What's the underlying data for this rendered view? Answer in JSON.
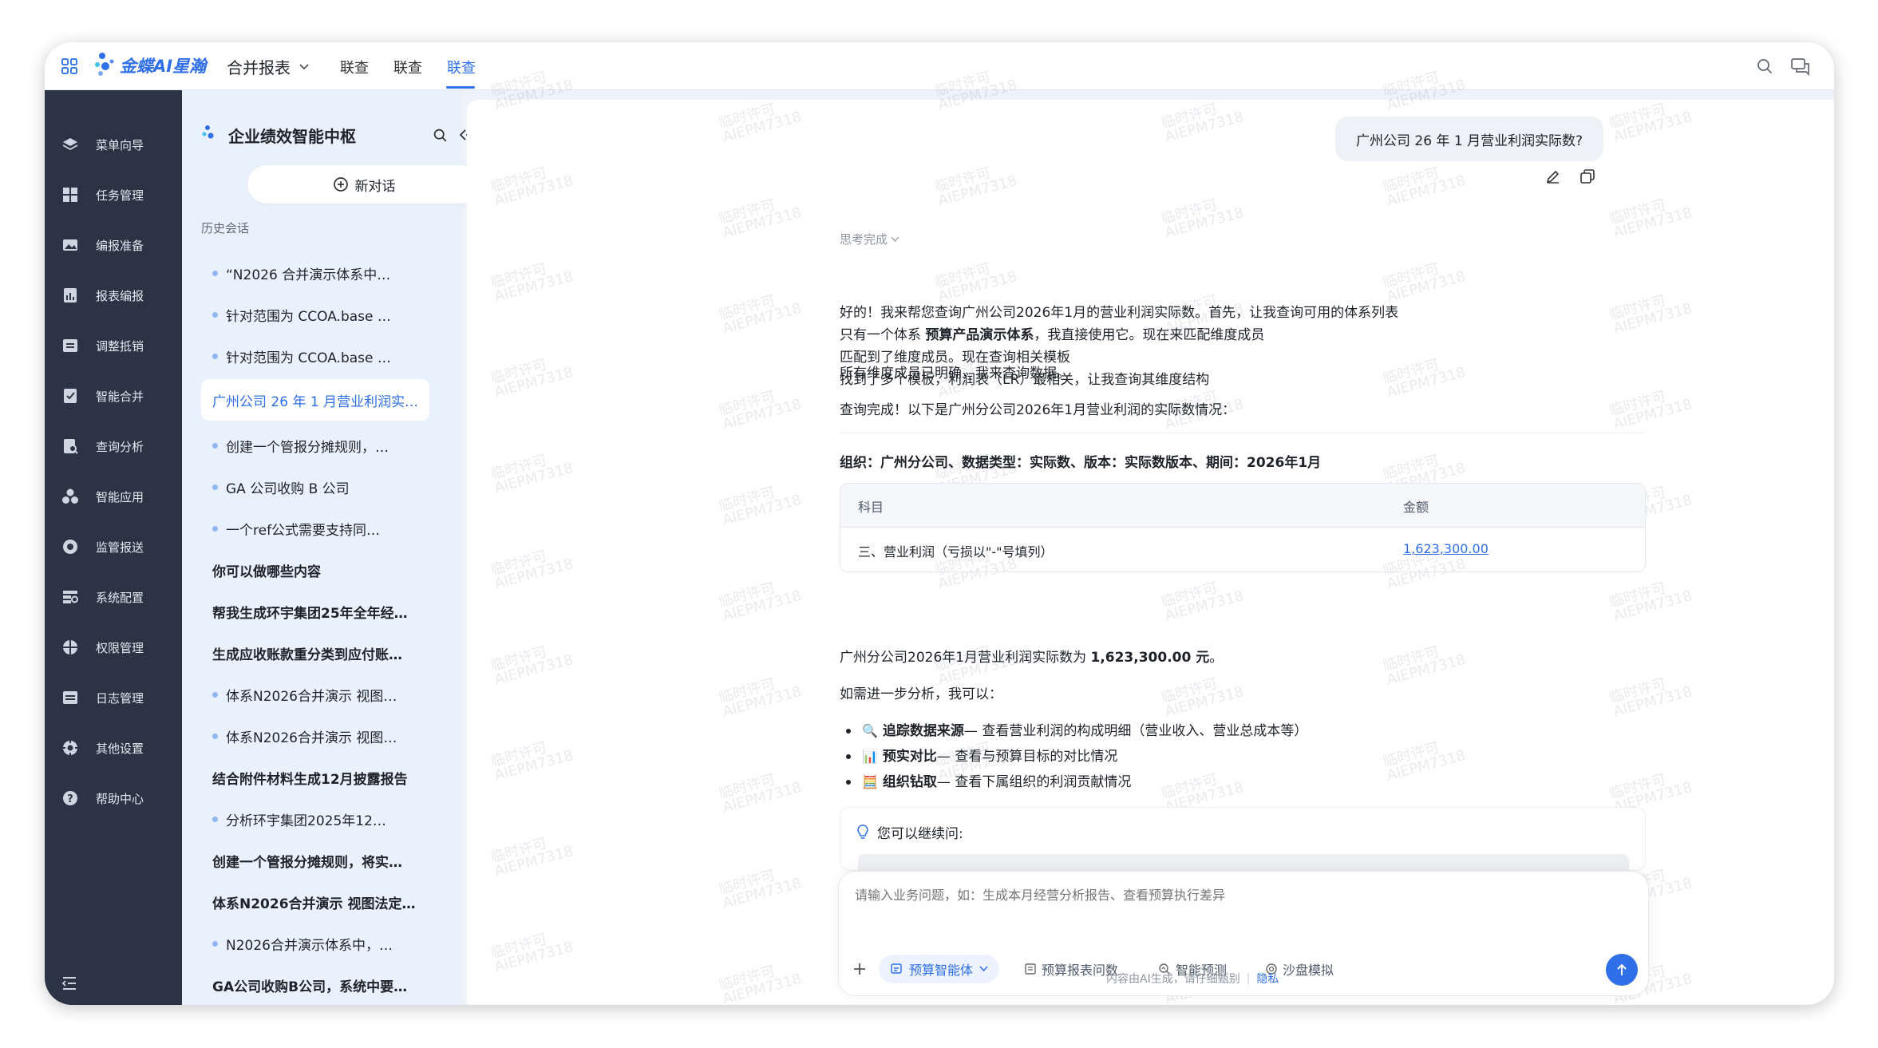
{
  "app": {
    "brand": "金蝶AI星瀚",
    "module": "合并报表",
    "tabs": [
      "联查",
      "联查",
      "联查"
    ],
    "active_tab_index": 2
  },
  "nav": {
    "items": [
      {
        "label": "菜单向导",
        "icon": "layers-icon"
      },
      {
        "label": "任务管理",
        "icon": "grid-icon"
      },
      {
        "label": "编报准备",
        "icon": "image-icon"
      },
      {
        "label": "报表编报",
        "icon": "report-icon"
      },
      {
        "label": "调整抵销",
        "icon": "adjust-icon"
      },
      {
        "label": "智能合并",
        "icon": "merge-icon"
      },
      {
        "label": "查询分析",
        "icon": "query-icon"
      },
      {
        "label": "智能应用",
        "icon": "apps-icon"
      },
      {
        "label": "监管报送",
        "icon": "target-icon"
      },
      {
        "label": "系统配置",
        "icon": "config-icon"
      },
      {
        "label": "权限管理",
        "icon": "shield-icon"
      },
      {
        "label": "日志管理",
        "icon": "log-icon"
      },
      {
        "label": "其他设置",
        "icon": "settings-icon"
      },
      {
        "label": "帮助中心",
        "icon": "help-icon"
      }
    ]
  },
  "panel": {
    "title": "企业绩效智能中枢",
    "new_chat": "新对话",
    "history_label": "历史会话",
    "history": [
      {
        "text": "“N2026 合并演示体系中…",
        "style": "dot"
      },
      {
        "text": "针对范围为 CCOA.base …",
        "style": "dot"
      },
      {
        "text": "针对范围为 CCOA.base …",
        "style": "dot"
      },
      {
        "text": "广州公司 26 年 1 月营业利润实…",
        "style": "active"
      },
      {
        "text": "创建一个管报分摊规则，…",
        "style": "dot"
      },
      {
        "text": "GA 公司收购 B 公司",
        "style": "dot"
      },
      {
        "text": "一个ref公式需要支持同…",
        "style": "dot"
      },
      {
        "text": "你可以做哪些内容",
        "style": "plain"
      },
      {
        "text": "帮我生成环宇集团25年全年经…",
        "style": "plain"
      },
      {
        "text": "生成应收账款重分类到应付账…",
        "style": "plain"
      },
      {
        "text": "体系N2026合并演示 视图…",
        "style": "dot"
      },
      {
        "text": "体系N2026合并演示 视图…",
        "style": "dot"
      },
      {
        "text": "结合附件材料生成12月披露报告",
        "style": "plain"
      },
      {
        "text": "分析环宇集团2025年12…",
        "style": "dot"
      },
      {
        "text": "创建一个管报分摊规则，将实…",
        "style": "plain"
      },
      {
        "text": "体系N2026合并演示 视图法定…",
        "style": "plain"
      },
      {
        "text": "N2026合并演示体系中，…",
        "style": "dot"
      },
      {
        "text": "GA公司收购B公司，系统中要…",
        "style": "plain"
      }
    ]
  },
  "chat": {
    "user_message": "广州公司 26 年 1 月营业利润实际数?",
    "thinking": "思考完成",
    "steps": [
      {
        "parts": [
          {
            "t": "好的！我来帮您查询广州公司2026年1月的营业利润实际数。首先，让我查询可用的体系列表",
            "b": false
          }
        ]
      },
      {
        "parts": [
          {
            "t": "只有一个体系 ",
            "b": false
          },
          {
            "t": "预算产品演示体系",
            "b": true
          },
          {
            "t": "，我直接使用它。现在来匹配维度成员",
            "b": false
          }
        ]
      },
      {
        "parts": [
          {
            "t": "匹配到了维度成员。现在查询相关模板",
            "b": false
          }
        ]
      },
      {
        "parts": [
          {
            "t": "找到了多个模板，利润表（LR）最相关，让我查询其维度结构",
            "b": false
          }
        ]
      }
    ],
    "members_clear": "所有维度成员已明确，我来查询数据。",
    "query_done": "查询完成！以下是广州分公司2026年1月营业利润的实际数情况：",
    "context_line": "组织：广州分公司、数据类型：实际数、版本：实际数版本、期间：2026年1月",
    "table": {
      "headers": [
        "科目",
        "金额"
      ],
      "rows": [
        {
          "subject": "三、营业利润（亏损以\"-\"号填列）",
          "amount": "1,623,300.00"
        }
      ]
    },
    "summary_prefix": "广州分公司2026年1月营业利润实际数为 ",
    "summary_value": "1,623,300.00 元",
    "summary_suffix": "。",
    "further": "如需进一步分析，我可以：",
    "bullets": [
      {
        "emoji": "🔍",
        "title": "追踪数据来源",
        "desc": " — 查看营业利润的构成明细（营业收入、营业总成本等）"
      },
      {
        "emoji": "📊",
        "title": "预实对比",
        "desc": " — 查看与预算目标的对比情况"
      },
      {
        "emoji": "🧮",
        "title": "组织钻取",
        "desc": " — 查看下属组织的利润贡献情况"
      }
    ],
    "followup_label": "您可以继续问:"
  },
  "input": {
    "placeholder": "请输入业务问题，如：生成本月经营分析报告、查看预算执行差异",
    "agent": "预算智能体",
    "tools": [
      "预算报表问数",
      "智能预测",
      "沙盘模拟"
    ]
  },
  "footer": {
    "disclaimer": "内容由AI生成，请仔细甄别",
    "privacy": "隐私"
  },
  "watermark": {
    "line1": "临时许可",
    "line2": "AIEPM7318"
  },
  "colors": {
    "accent": "#2f6fe8",
    "nav_bg": "#2b3445",
    "panel_bg": "#e9f1fc"
  }
}
